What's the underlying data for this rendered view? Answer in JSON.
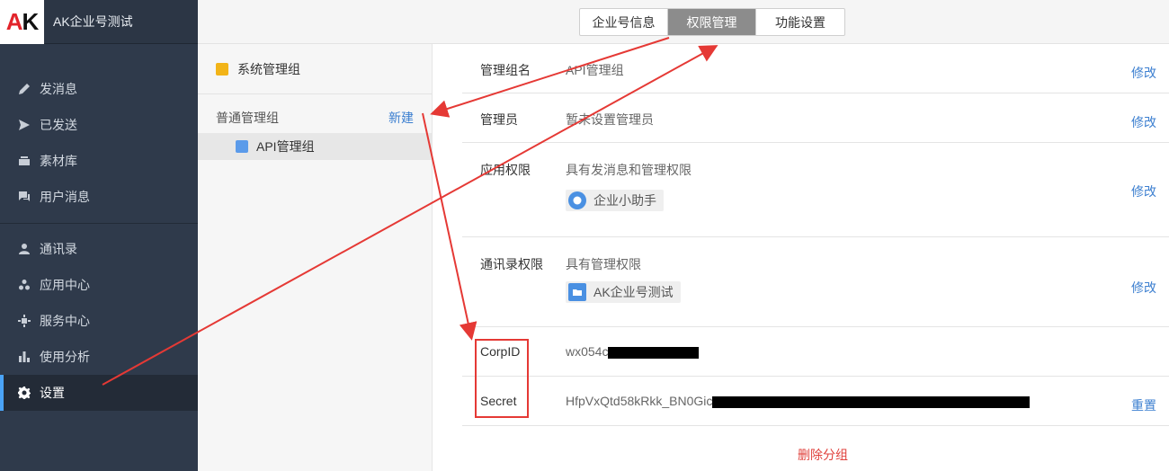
{
  "app": {
    "logo_a": "A",
    "logo_k": "K",
    "title": "AK企业号测试"
  },
  "sidebar": {
    "items": [
      {
        "label": "发消息",
        "icon": "pencil-icon"
      },
      {
        "label": "已发送",
        "icon": "send-icon"
      },
      {
        "label": "素材库",
        "icon": "inbox-icon"
      },
      {
        "label": "用户消息",
        "icon": "chat-icon"
      }
    ],
    "items2": [
      {
        "label": "通讯录",
        "icon": "user-icon"
      },
      {
        "label": "应用中心",
        "icon": "apps-icon"
      },
      {
        "label": "服务中心",
        "icon": "service-icon"
      },
      {
        "label": "使用分析",
        "icon": "bar-chart-icon"
      },
      {
        "label": "设置",
        "icon": "gear-icon",
        "active": true
      }
    ]
  },
  "tabs": [
    {
      "label": "企业号信息"
    },
    {
      "label": "权限管理",
      "active": true
    },
    {
      "label": "功能设置"
    }
  ],
  "groups": {
    "system": "系统管理组",
    "ordinary_title": "普通管理组",
    "new_label": "新建",
    "items": [
      "API管理组"
    ]
  },
  "detail": {
    "group_name_label": "管理组名",
    "group_name_value": "API管理组",
    "admin_label": "管理员",
    "admin_value": "暂未设置管理员",
    "app_perm_label": "应用权限",
    "app_perm_value": "具有发消息和管理权限",
    "app_chip": "企业小助手",
    "contact_perm_label": "通讯录权限",
    "contact_perm_value": "具有管理权限",
    "contact_chip": "AK企业号测试",
    "corpid_label": "CorpID",
    "corpid_value": "wx054c",
    "secret_label": "Secret",
    "secret_value": "HfpVxQtd58kRkk_BN0Gic",
    "edit": "修改",
    "reset": "重置",
    "delete_group": "删除分组"
  },
  "colors": {
    "sidebar": "#2f3a4b",
    "accent": "#3c7fd0",
    "annotation": "#e53935",
    "danger": "#e0413c"
  }
}
